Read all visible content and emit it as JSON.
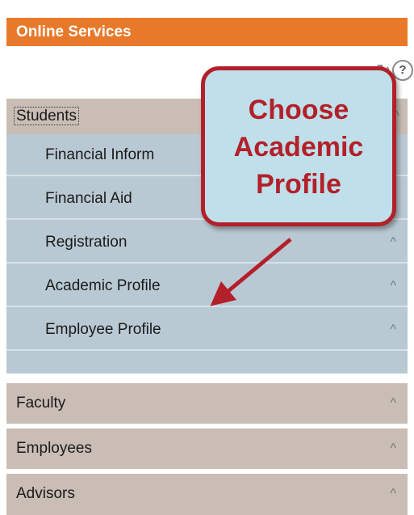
{
  "header": {
    "title": "Online Services"
  },
  "tools": {
    "refresh_glyph": "↻",
    "help_glyph": "?"
  },
  "students": {
    "label": "Students",
    "items": [
      {
        "label": "Financial Inform"
      },
      {
        "label": "Financial Aid"
      },
      {
        "label": "Registration"
      },
      {
        "label": "Academic Profile"
      },
      {
        "label": "Employee Profile"
      }
    ]
  },
  "sections": [
    {
      "label": "Faculty"
    },
    {
      "label": "Employees"
    },
    {
      "label": "Advisors"
    }
  ],
  "chevron": "^",
  "callout": {
    "lines": [
      "Choose",
      "Academic",
      "Profile"
    ]
  },
  "colors": {
    "header_bg": "#e8792a",
    "section_bg": "#c9bdb5",
    "subitem_bg": "#b9c9d3",
    "callout_bg": "#bfe0ea",
    "callout_accent": "#b3202a"
  }
}
